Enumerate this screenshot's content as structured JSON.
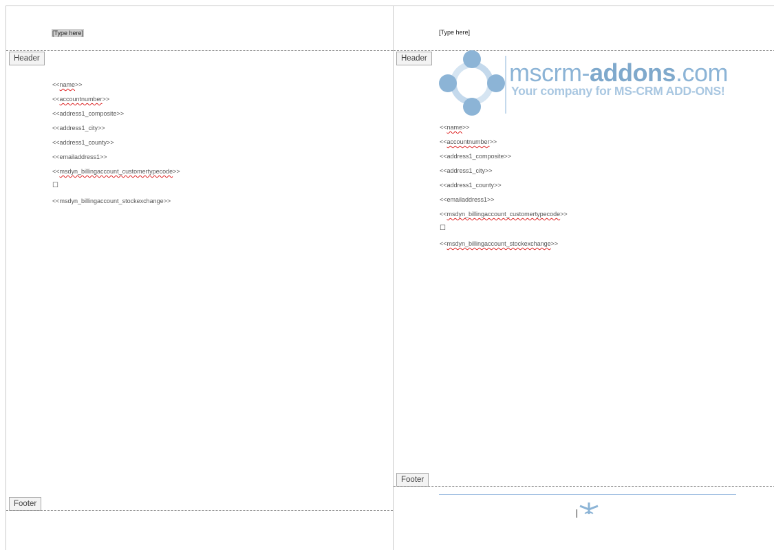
{
  "left_page": {
    "header_placeholder": "[Type here]",
    "header_tag": "Header",
    "footer_tag": "Footer",
    "fields": [
      {
        "pre": "<<",
        "word": "name",
        "post": ">>"
      },
      {
        "pre": "<<",
        "word": "accountnumber",
        "post": ">>"
      },
      {
        "pre": "<<address1_composite>>",
        "word": "",
        "post": ""
      },
      {
        "pre": "<<address1_city>>",
        "word": "",
        "post": ""
      },
      {
        "pre": "<<address1_county>>",
        "word": "",
        "post": ""
      },
      {
        "pre": "<<emailaddress1>>",
        "word": "",
        "post": ""
      },
      {
        "pre": "<<",
        "word": "msdyn_billingaccount_customertypecode",
        "post": ">>"
      },
      {
        "pre": "☐",
        "word": "",
        "post": ""
      },
      {
        "pre": "<<msdyn_billingaccount_stockexchange>>",
        "word": "",
        "post": ""
      }
    ]
  },
  "right_page": {
    "header_placeholder": "[Type here]",
    "header_tag": "Header",
    "footer_tag": "Footer",
    "logo": {
      "line1_light": "mscrm-",
      "line1_bold": "addons",
      "line1_tail": ".com",
      "line2": "Your company for MS-CRM ADD-ONS!"
    },
    "fields": [
      {
        "pre": "<<",
        "word": "name",
        "post": ">>"
      },
      {
        "pre": "<<",
        "word": "accountnumber",
        "post": ">>"
      },
      {
        "pre": "<<address1_composite>>",
        "word": "",
        "post": ""
      },
      {
        "pre": "<<address1_city>>",
        "word": "",
        "post": ""
      },
      {
        "pre": "<<address1_county>>",
        "word": "",
        "post": ""
      },
      {
        "pre": "<<emailaddress1>>",
        "word": "",
        "post": ""
      },
      {
        "pre": "<<",
        "word": "msdyn_billingaccount_customertypecode",
        "post": ">>"
      },
      {
        "pre": "☐",
        "word": "",
        "post": ""
      },
      {
        "pre": "<<",
        "word": "msdyn_billingaccount_stockexchange",
        "post": ">>"
      }
    ]
  },
  "colors": {
    "logo_blue": "#8cb4d6",
    "footer_rule": "#9bbbe0",
    "squiggle": "#dd2222"
  },
  "icons": {
    "footer_icon": "plane-icon"
  }
}
